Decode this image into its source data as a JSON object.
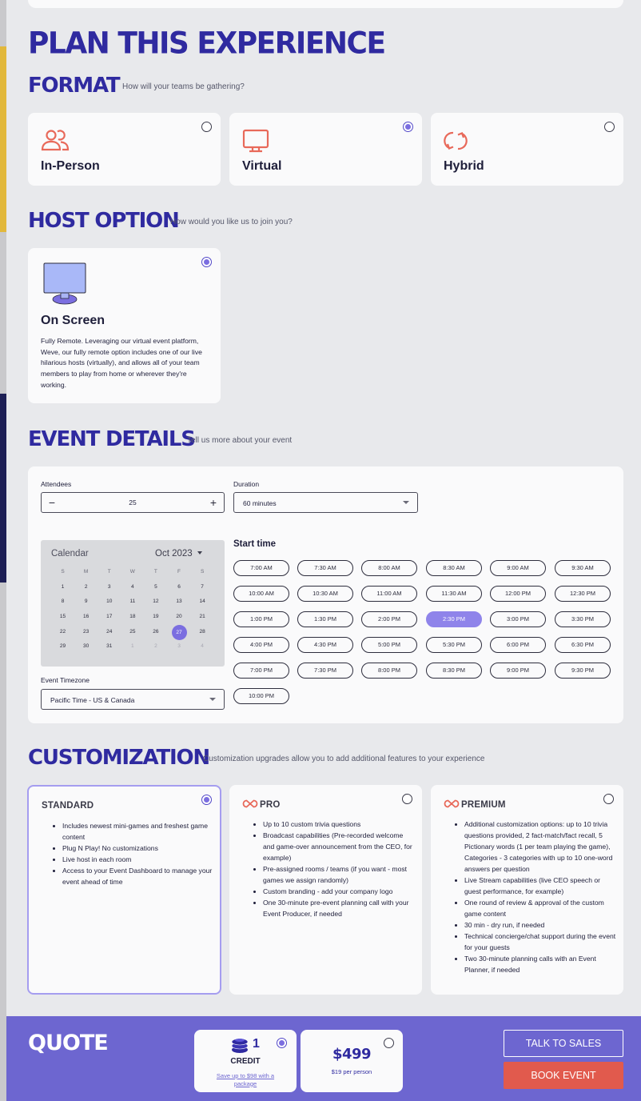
{
  "title": "PLAN THIS EXPERIENCE",
  "format": {
    "title": "FORMAT",
    "subtitle": "How will your teams be gathering?",
    "options": [
      {
        "label": "In-Person",
        "selected": false,
        "icon": "people-icon"
      },
      {
        "label": "Virtual",
        "selected": true,
        "icon": "monitor-icon"
      },
      {
        "label": "Hybrid",
        "selected": false,
        "icon": "refresh-icon"
      }
    ],
    "icon_color": "#e8695a"
  },
  "host": {
    "title": "HOST OPTION",
    "subtitle": "How would you like us to join you?",
    "option": {
      "label": "On Screen",
      "selected": true,
      "description": "Fully Remote. Leveraging our virtual event platform, Weve, our fully remote option includes one of our live hilarious hosts (virtually), and allows all of your team members to play from home or wherever they're working."
    }
  },
  "details": {
    "title": "EVENT DETAILS",
    "subtitle": "Tell us more about your event",
    "attendees_label": "Attendees",
    "attendees_value": "25",
    "duration_label": "Duration",
    "duration_value": "60 minutes",
    "calendar_label": "Calendar",
    "month": "Oct 2023",
    "weekdays": [
      "S",
      "M",
      "T",
      "W",
      "T",
      "F",
      "S"
    ],
    "days": [
      "1",
      "2",
      "3",
      "4",
      "5",
      "6",
      "7",
      "8",
      "9",
      "10",
      "11",
      "12",
      "13",
      "14",
      "15",
      "16",
      "17",
      "18",
      "19",
      "20",
      "21",
      "22",
      "23",
      "24",
      "25",
      "26",
      "27",
      "28",
      "29",
      "30",
      "31",
      "1",
      "2",
      "3",
      "4"
    ],
    "selected_day": "27",
    "timezone_label": "Event Timezone",
    "timezone_value": "Pacific Time - US & Canada",
    "start_time_label": "Start time",
    "times": [
      "7:00 AM",
      "7:30 AM",
      "8:00 AM",
      "8:30 AM",
      "9:00 AM",
      "9:30 AM",
      "10:00 AM",
      "10:30 AM",
      "11:00 AM",
      "11:30 AM",
      "12:00 PM",
      "12:30 PM",
      "1:00 PM",
      "1:30 PM",
      "2:00 PM",
      "2:30 PM",
      "3:00 PM",
      "3:30 PM",
      "4:00 PM",
      "4:30 PM",
      "5:00 PM",
      "5:30 PM",
      "6:00 PM",
      "6:30 PM",
      "7:00 PM",
      "7:30 PM",
      "8:00 PM",
      "8:30 PM",
      "9:00 PM",
      "9:30 PM",
      "10:00 PM"
    ],
    "selected_time": "2:30 PM"
  },
  "customization": {
    "title": "CUSTOMIZATION",
    "subtitle": "Customization upgrades allow you to add additional features to your experience",
    "tiers": [
      {
        "name": "STANDARD",
        "selected": true,
        "features": [
          "Includes newest mini-games and freshest game content",
          "Plug N Play! No customizations",
          "Live host in each room",
          "Access to your Event Dashboard to manage your event ahead of time"
        ]
      },
      {
        "name": "PRO",
        "selected": false,
        "features": [
          "Up to 10 custom trivia questions",
          "Broadcast capabilities (Pre-recorded welcome and game-over announcement from the CEO, for example)",
          "Pre-assigned rooms / teams (if you want - most games we assign randomly)",
          "Custom branding - add your company logo",
          "One 30-minute pre-event planning call with your Event Producer, if needed"
        ]
      },
      {
        "name": "PREMIUM",
        "selected": false,
        "features": [
          "Additional customization options: up to 10 trivia questions provided, 2 fact-match/fact recall, 5 Pictionary words (1 per team playing the game), Categories - 3 categories with up to 10 one-word answers per question",
          "Live Stream capabilities (live CEO speech or guest performance, for example)",
          "One round of review & approval of the custom game content",
          "30 min - dry run, if needed",
          "Technical concierge/chat support during the event for your guests",
          "Two 30-minute planning calls with an Event Planner, if needed"
        ]
      }
    ]
  },
  "quote": {
    "title": "QUOTE",
    "credit_amount": "1",
    "credit_label": "CREDIT",
    "credit_link": "Save up to $98 with a package",
    "price": "$499",
    "per_person": "$19 per person",
    "talk_to_sales": "TALK TO SALES",
    "book_event": "BOOK EVENT"
  },
  "colors": {
    "accent": "#2f2aa0",
    "selected": "#7b6ee0",
    "quote_bar": "#6d66d0",
    "book_button": "#e15a4d"
  }
}
